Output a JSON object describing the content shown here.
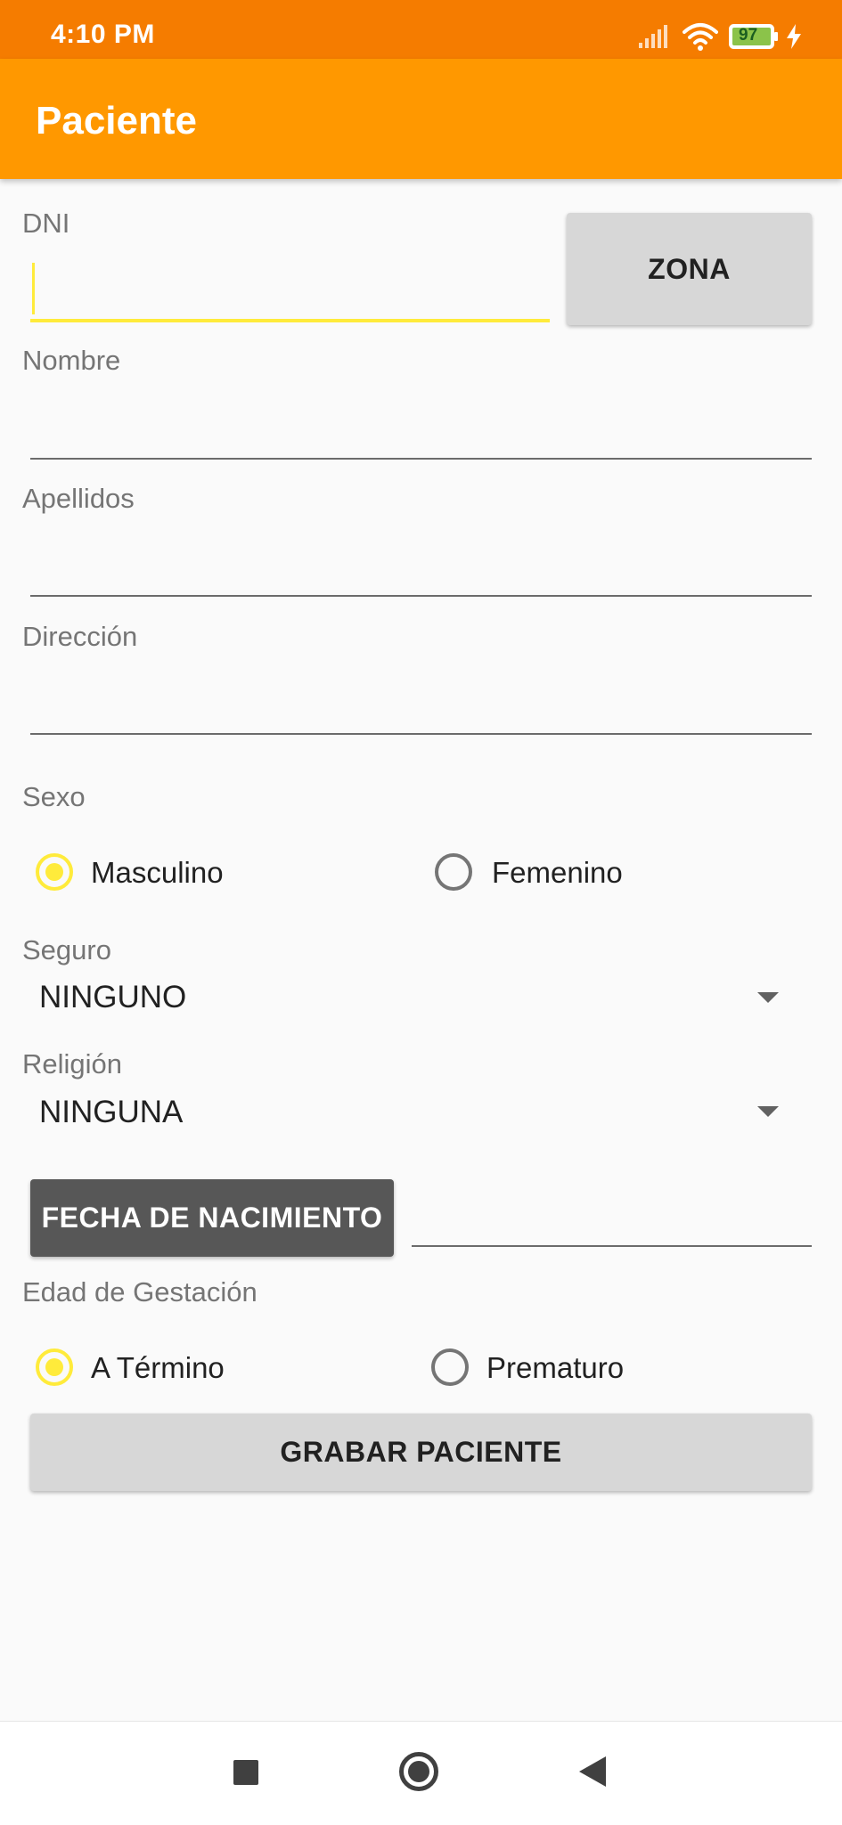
{
  "status_bar": {
    "time": "4:10 PM",
    "battery": "97"
  },
  "app_bar": {
    "title": "Paciente"
  },
  "form": {
    "dni": {
      "label": "DNI",
      "value": ""
    },
    "zona_button": "ZONA",
    "nombre": {
      "label": "Nombre",
      "value": ""
    },
    "apellidos": {
      "label": "Apellidos",
      "value": ""
    },
    "direccion": {
      "label": "Dirección",
      "value": ""
    },
    "sexo": {
      "label": "Sexo",
      "options": [
        "Masculino",
        "Femenino"
      ],
      "selected": "Masculino"
    },
    "seguro": {
      "label": "Seguro",
      "value": "NINGUNO"
    },
    "religion": {
      "label": "Religión",
      "value": "NINGUNA"
    },
    "fecha_button": "FECHA DE NACIMIENTO",
    "fecha_value": "",
    "gestacion": {
      "label": "Edad de Gestación",
      "options": [
        "A Término",
        "Prematuro"
      ],
      "selected": "A Término"
    },
    "save_button": "GRABAR PACIENTE"
  },
  "colors": {
    "status_bar": "#f57c00",
    "app_bar": "#ff9800",
    "accent": "#ffeb3b",
    "dark_button": "#575757",
    "button": "#d7d7d7"
  },
  "icons": [
    "signal-icon",
    "wifi-icon",
    "battery-icon",
    "charging-icon",
    "dropdown-arrow-icon",
    "nav-recents-icon",
    "nav-home-icon",
    "nav-back-icon"
  ]
}
